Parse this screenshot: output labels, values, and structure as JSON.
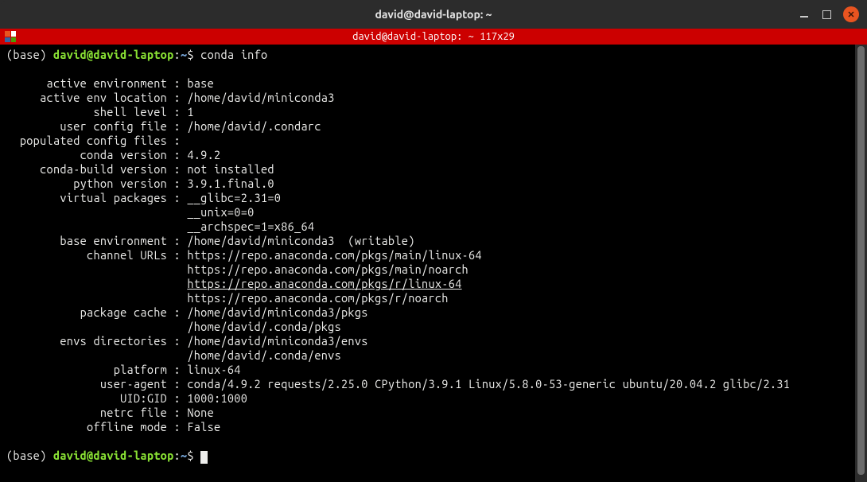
{
  "titlebar": {
    "title": "david@david-laptop: ~"
  },
  "tabbar": {
    "label": "david@david-laptop: ~ 117x29"
  },
  "prompt": {
    "env": "(base)",
    "userhost": "david@david-laptop",
    "sep": ":",
    "path": "~",
    "dollar": "$"
  },
  "cmd1": "conda info",
  "info": {
    "rows": [
      {
        "k": "active environment",
        "v": [
          "base"
        ]
      },
      {
        "k": "active env location",
        "v": [
          "/home/david/miniconda3"
        ]
      },
      {
        "k": "shell level",
        "v": [
          "1"
        ]
      },
      {
        "k": "user config file",
        "v": [
          "/home/david/.condarc"
        ]
      },
      {
        "k": "populated config files",
        "v": [
          ""
        ]
      },
      {
        "k": "conda version",
        "v": [
          "4.9.2"
        ]
      },
      {
        "k": "conda-build version",
        "v": [
          "not installed"
        ]
      },
      {
        "k": "python version",
        "v": [
          "3.9.1.final.0"
        ]
      },
      {
        "k": "virtual packages",
        "v": [
          "__glibc=2.31=0",
          "__unix=0=0",
          "__archspec=1=x86_64"
        ]
      },
      {
        "k": "base environment",
        "v": [
          "/home/david/miniconda3  (writable)"
        ]
      },
      {
        "k": "channel URLs",
        "v": [
          "https://repo.anaconda.com/pkgs/main/linux-64",
          "https://repo.anaconda.com/pkgs/main/noarch",
          "https://repo.anaconda.com/pkgs/r/linux-64",
          "https://repo.anaconda.com/pkgs/r/noarch"
        ],
        "ul": 2
      },
      {
        "k": "package cache",
        "v": [
          "/home/david/miniconda3/pkgs",
          "/home/david/.conda/pkgs"
        ]
      },
      {
        "k": "envs directories",
        "v": [
          "/home/david/miniconda3/envs",
          "/home/david/.conda/envs"
        ]
      },
      {
        "k": "platform",
        "v": [
          "linux-64"
        ]
      },
      {
        "k": "user-agent",
        "v": [
          "conda/4.9.2 requests/2.25.0 CPython/3.9.1 Linux/5.8.0-53-generic ubuntu/20.04.2 glibc/2.31"
        ]
      },
      {
        "k": "UID:GID",
        "v": [
          "1000:1000"
        ]
      },
      {
        "k": "netrc file",
        "v": [
          "None"
        ]
      },
      {
        "k": "offline mode",
        "v": [
          "False"
        ]
      }
    ],
    "labelWidth": 24,
    "indent": 27
  }
}
